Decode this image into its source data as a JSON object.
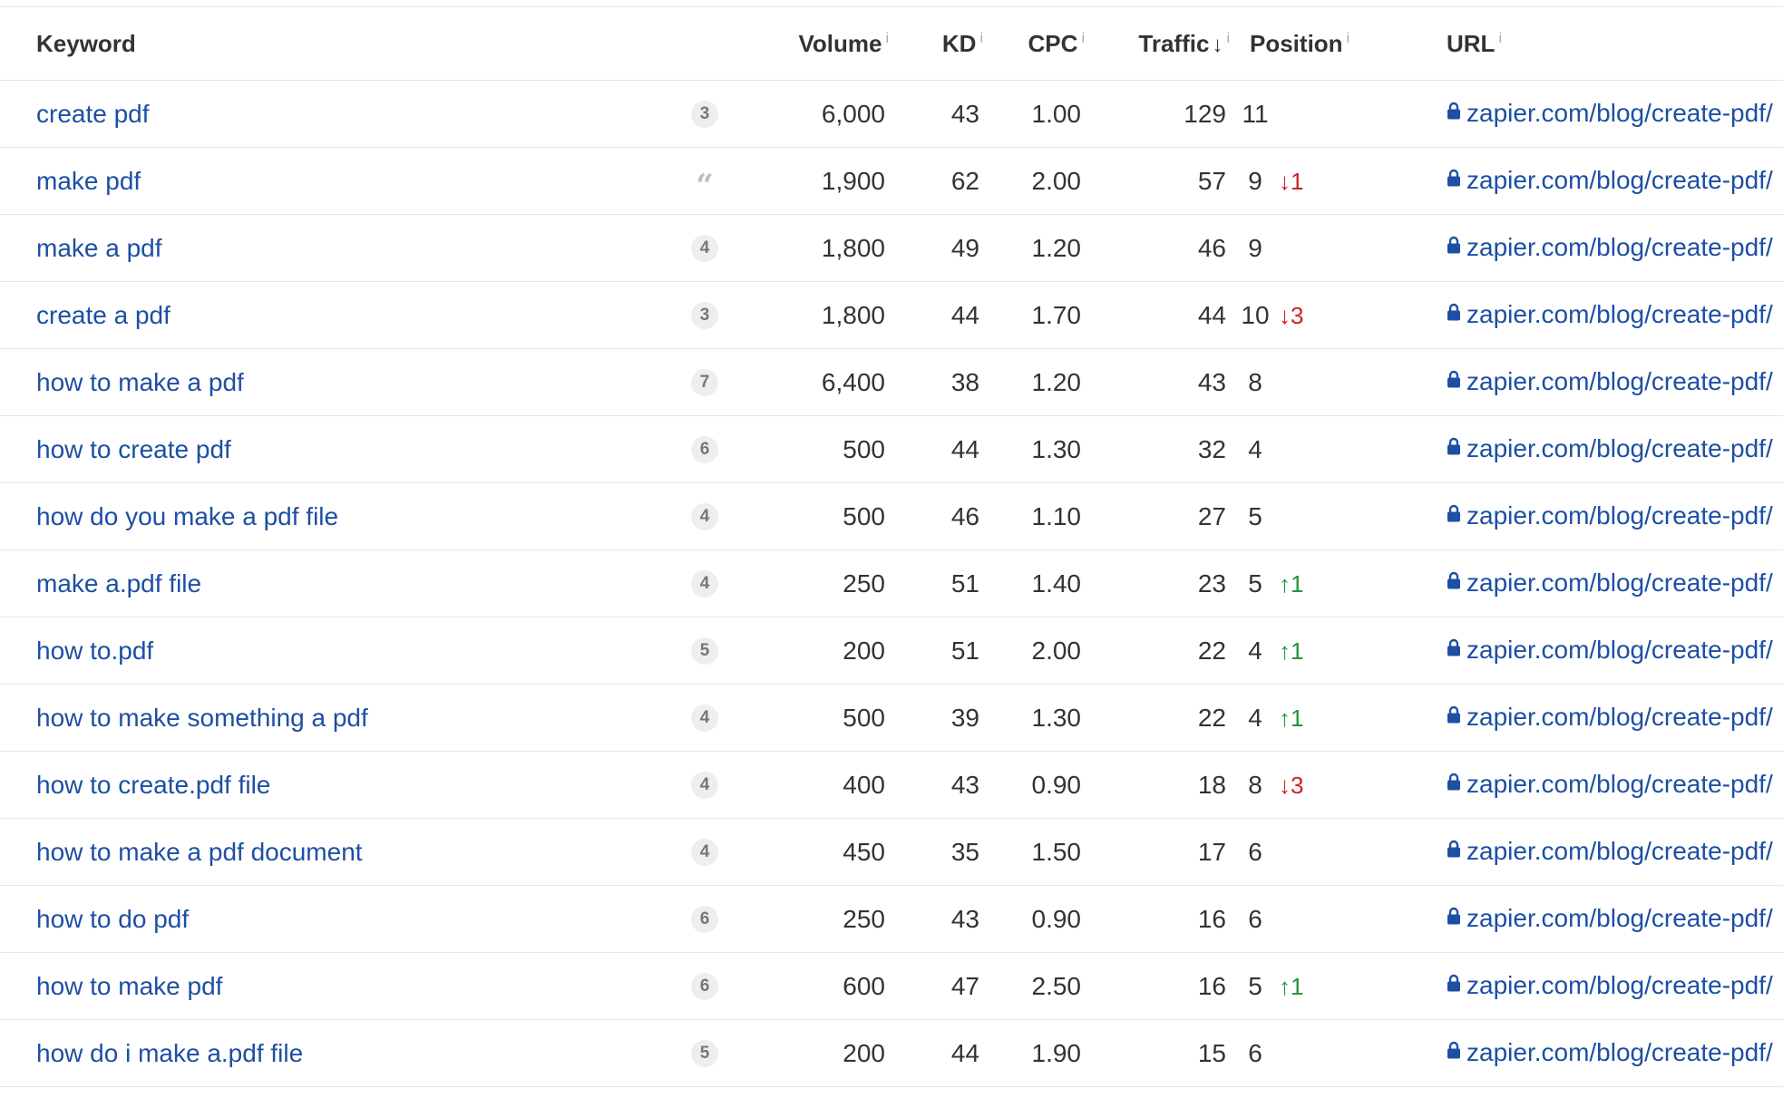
{
  "headers": {
    "keyword": "Keyword",
    "volume": "Volume",
    "kd": "KD",
    "cpc": "CPC",
    "traffic": "Traffic",
    "position": "Position",
    "url": "URL",
    "info_glyph": "i",
    "sort_glyph": "↓"
  },
  "colors": {
    "link": "#1d4fa3",
    "down": "#d21f1f",
    "up": "#23963a",
    "badge_bg": "#eeeeee"
  },
  "rows": [
    {
      "keyword": "create pdf",
      "serp": "3",
      "serp_icon": "",
      "volume": "6,000",
      "kd": "43",
      "cpc": "1.00",
      "traffic": "129",
      "position": "11",
      "change_dir": "",
      "change_arrow": "",
      "change": "",
      "url": "zapier.com/blog/create-pdf/"
    },
    {
      "keyword": "make pdf",
      "serp": "",
      "serp_icon": "quote-icon",
      "volume": "1,900",
      "kd": "62",
      "cpc": "2.00",
      "traffic": "57",
      "position": "9",
      "change_dir": "down",
      "change_arrow": "↓",
      "change": "1",
      "url": "zapier.com/blog/create-pdf/"
    },
    {
      "keyword": "make a pdf",
      "serp": "4",
      "serp_icon": "",
      "volume": "1,800",
      "kd": "49",
      "cpc": "1.20",
      "traffic": "46",
      "position": "9",
      "change_dir": "",
      "change_arrow": "",
      "change": "",
      "url": "zapier.com/blog/create-pdf/"
    },
    {
      "keyword": "create a pdf",
      "serp": "3",
      "serp_icon": "",
      "volume": "1,800",
      "kd": "44",
      "cpc": "1.70",
      "traffic": "44",
      "position": "10",
      "change_dir": "down",
      "change_arrow": "↓",
      "change": "3",
      "url": "zapier.com/blog/create-pdf/"
    },
    {
      "keyword": "how to make a pdf",
      "serp": "7",
      "serp_icon": "",
      "volume": "6,400",
      "kd": "38",
      "cpc": "1.20",
      "traffic": "43",
      "position": "8",
      "change_dir": "",
      "change_arrow": "",
      "change": "",
      "url": "zapier.com/blog/create-pdf/"
    },
    {
      "keyword": "how to create pdf",
      "serp": "6",
      "serp_icon": "",
      "volume": "500",
      "kd": "44",
      "cpc": "1.30",
      "traffic": "32",
      "position": "4",
      "change_dir": "",
      "change_arrow": "",
      "change": "",
      "url": "zapier.com/blog/create-pdf/"
    },
    {
      "keyword": "how do you make a pdf file",
      "serp": "4",
      "serp_icon": "",
      "volume": "500",
      "kd": "46",
      "cpc": "1.10",
      "traffic": "27",
      "position": "5",
      "change_dir": "",
      "change_arrow": "",
      "change": "",
      "url": "zapier.com/blog/create-pdf/"
    },
    {
      "keyword": "make a.pdf file",
      "serp": "4",
      "serp_icon": "",
      "volume": "250",
      "kd": "51",
      "cpc": "1.40",
      "traffic": "23",
      "position": "5",
      "change_dir": "up",
      "change_arrow": "↑",
      "change": "1",
      "url": "zapier.com/blog/create-pdf/"
    },
    {
      "keyword": "how to.pdf",
      "serp": "5",
      "serp_icon": "",
      "volume": "200",
      "kd": "51",
      "cpc": "2.00",
      "traffic": "22",
      "position": "4",
      "change_dir": "up",
      "change_arrow": "↑",
      "change": "1",
      "url": "zapier.com/blog/create-pdf/"
    },
    {
      "keyword": "how to make something a pdf",
      "serp": "4",
      "serp_icon": "",
      "volume": "500",
      "kd": "39",
      "cpc": "1.30",
      "traffic": "22",
      "position": "4",
      "change_dir": "up",
      "change_arrow": "↑",
      "change": "1",
      "url": "zapier.com/blog/create-pdf/"
    },
    {
      "keyword": "how to create.pdf file",
      "serp": "4",
      "serp_icon": "",
      "volume": "400",
      "kd": "43",
      "cpc": "0.90",
      "traffic": "18",
      "position": "8",
      "change_dir": "down",
      "change_arrow": "↓",
      "change": "3",
      "url": "zapier.com/blog/create-pdf/"
    },
    {
      "keyword": "how to make a pdf document",
      "serp": "4",
      "serp_icon": "",
      "volume": "450",
      "kd": "35",
      "cpc": "1.50",
      "traffic": "17",
      "position": "6",
      "change_dir": "",
      "change_arrow": "",
      "change": "",
      "url": "zapier.com/blog/create-pdf/"
    },
    {
      "keyword": "how to do pdf",
      "serp": "6",
      "serp_icon": "",
      "volume": "250",
      "kd": "43",
      "cpc": "0.90",
      "traffic": "16",
      "position": "6",
      "change_dir": "",
      "change_arrow": "",
      "change": "",
      "url": "zapier.com/blog/create-pdf/"
    },
    {
      "keyword": "how to make pdf",
      "serp": "6",
      "serp_icon": "",
      "volume": "600",
      "kd": "47",
      "cpc": "2.50",
      "traffic": "16",
      "position": "5",
      "change_dir": "up",
      "change_arrow": "↑",
      "change": "1",
      "url": "zapier.com/blog/create-pdf/"
    },
    {
      "keyword": "how do i make a.pdf file",
      "serp": "5",
      "serp_icon": "",
      "volume": "200",
      "kd": "44",
      "cpc": "1.90",
      "traffic": "15",
      "position": "6",
      "change_dir": "",
      "change_arrow": "",
      "change": "",
      "url": "zapier.com/blog/create-pdf/"
    }
  ]
}
